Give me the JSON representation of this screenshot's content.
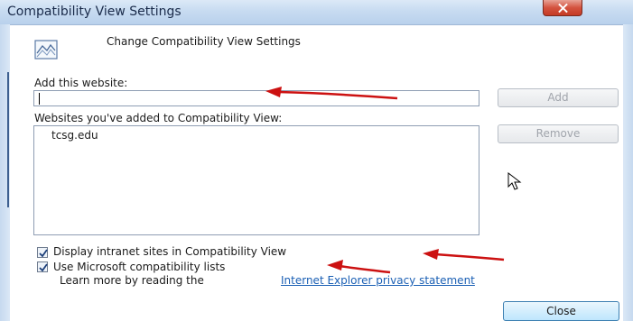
{
  "window": {
    "title": "Compatibility View Settings"
  },
  "header": {
    "text": "Change Compatibility View Settings",
    "icon": "compat-view-icon"
  },
  "add_site": {
    "label": "Add this website:",
    "value": "",
    "button": "Add"
  },
  "site_list": {
    "label": "Websites you've added to Compatibility View:",
    "items": [
      "tcsg.edu"
    ],
    "remove_button": "Remove"
  },
  "options": {
    "intranet": {
      "label": "Display intranet sites in Compatibility View",
      "checked": true
    },
    "microsoft_lists": {
      "label": "Use Microsoft compatibility lists",
      "checked": true
    }
  },
  "learn_more": {
    "text": "Learn more by reading the",
    "link": "Internet Explorer privacy statement"
  },
  "footer": {
    "close_button": "Close"
  },
  "colors": {
    "annotation_arrow": "#cc1111",
    "link": "#1a5fb4"
  }
}
